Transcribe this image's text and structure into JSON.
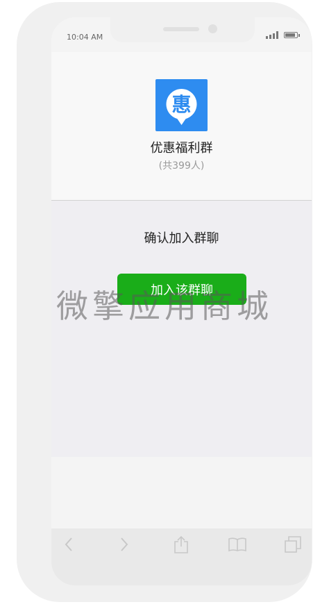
{
  "status_bar": {
    "time": "10:04 AM"
  },
  "group": {
    "avatar_glyph": "惠",
    "name": "优惠福利群",
    "member_count": "(共399人)"
  },
  "confirm": {
    "prompt": "确认加入群聊",
    "join_button": "加入该群聊"
  },
  "toolbar": {
    "icons": [
      "back-arrow-icon",
      "forward-arrow-icon",
      "share-icon",
      "bookmarks-icon",
      "tabs-icon"
    ]
  },
  "watermark": "微擎应用商城",
  "colors": {
    "avatar_bg": "#2e8cf0",
    "join_button_bg": "#1aad19",
    "panel_bg": "#efeef2"
  }
}
